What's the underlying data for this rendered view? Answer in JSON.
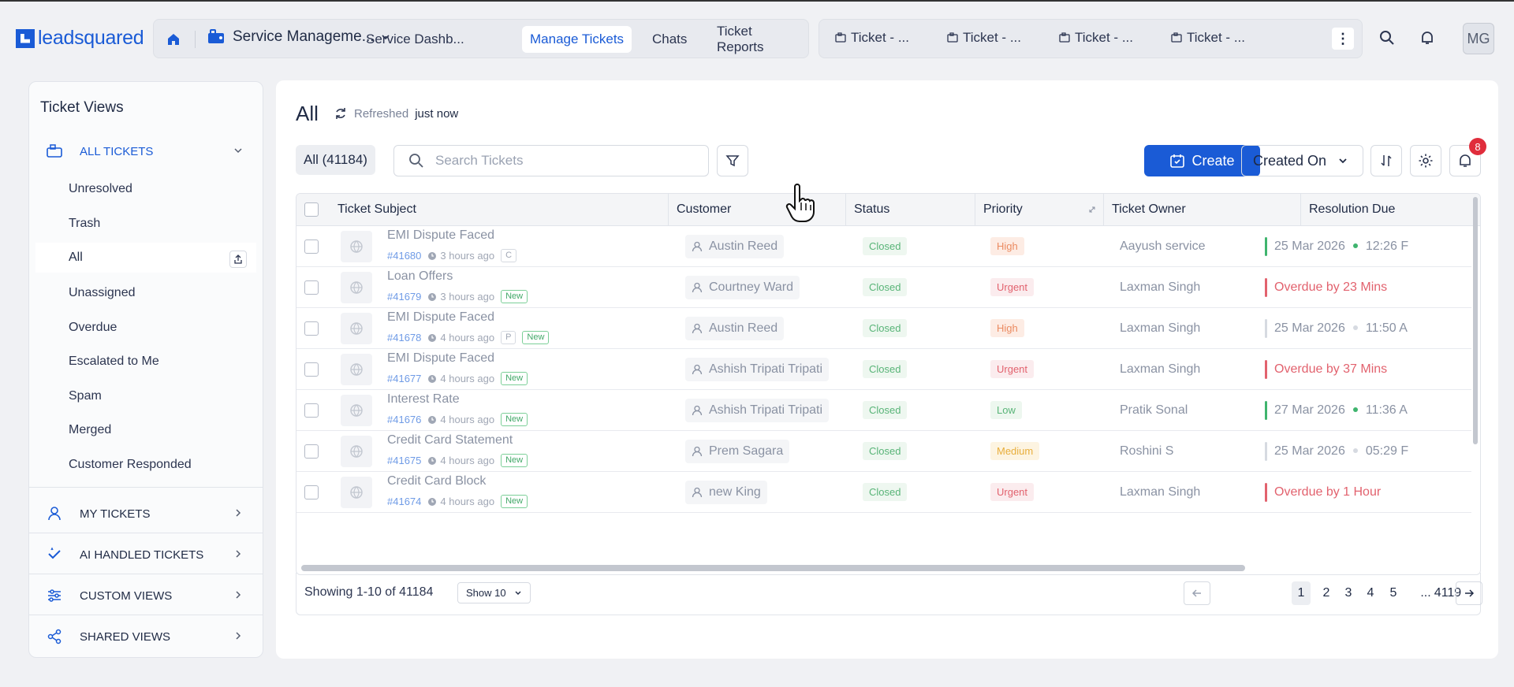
{
  "brand": {
    "name": "leadsquared"
  },
  "nav": {
    "app_name": "Service Manageme...",
    "tabs": [
      "Service Dashb...",
      "Manage Tickets",
      "Chats",
      "Ticket Reports"
    ],
    "active_tab": "Manage Tickets",
    "recent_tabs": [
      "Ticket - ...",
      "Ticket - ...",
      "Ticket - ...",
      "Ticket - ..."
    ],
    "avatar": "MG"
  },
  "sidebar": {
    "title": "Ticket Views",
    "sections": [
      {
        "label": "ALL TICKETS",
        "icon": "tickets-icon",
        "expanded": true
      },
      {
        "label": "MY TICKETS",
        "icon": "user-icon"
      },
      {
        "label": "AI HANDLED TICKETS",
        "icon": "ai-check-icon"
      },
      {
        "label": "CUSTOM VIEWS",
        "icon": "sliders-icon"
      },
      {
        "label": "SHARED VIEWS",
        "icon": "share-icon"
      }
    ],
    "items": [
      "Unresolved",
      "Trash",
      "All",
      "Unassigned",
      "Overdue",
      "Escalated to Me",
      "Spam",
      "Merged",
      "Customer Responded"
    ],
    "active_item": "All"
  },
  "main": {
    "title": "All",
    "refresh_label": "Refreshed",
    "refresh_time": "just now",
    "count_chip": "All (41184)",
    "search_placeholder": "Search Tickets",
    "create_label": "Create",
    "sort_label": "Created On",
    "notifications_count": "8"
  },
  "table": {
    "columns": [
      "Ticket Subject",
      "Customer",
      "Status",
      "Priority",
      "Ticket Owner",
      "Resolution Due"
    ],
    "rows": [
      {
        "subject": "EMI Dispute Faced",
        "id": "#41680",
        "ago": "3 hours ago",
        "tags": [
          "C"
        ],
        "customer": "Austin Reed",
        "status": "Closed",
        "priority": "High",
        "owner": "Aayush service",
        "due": "25 Mar 2026",
        "due_time": "12:26 F",
        "overdue": false,
        "bar": "#3fb46e",
        "dot": "#3fb46e"
      },
      {
        "subject": "Loan Offers",
        "id": "#41679",
        "ago": "3 hours ago",
        "tags": [
          "New"
        ],
        "customer": "Courtney Ward",
        "status": "Closed",
        "priority": "Urgent",
        "owner": "Laxman Singh",
        "due": "Overdue by 23 Mins",
        "due_time": "",
        "overdue": true,
        "bar": "#e2626e",
        "dot": ""
      },
      {
        "subject": "EMI Dispute Faced",
        "id": "#41678",
        "ago": "4 hours ago",
        "tags": [
          "P",
          "New"
        ],
        "customer": "Austin Reed",
        "status": "Closed",
        "priority": "High",
        "owner": "Laxman Singh",
        "due": "25 Mar 2026",
        "due_time": "11:50 A",
        "overdue": false,
        "bar": "#d6dae1",
        "dot": "#d6dae1"
      },
      {
        "subject": "EMI Dispute Faced",
        "id": "#41677",
        "ago": "4 hours ago",
        "tags": [
          "New"
        ],
        "customer": "Ashish Tripati Tripati",
        "status": "Closed",
        "priority": "Urgent",
        "owner": "Laxman Singh",
        "due": "Overdue by 37 Mins",
        "due_time": "",
        "overdue": true,
        "bar": "#e2626e",
        "dot": ""
      },
      {
        "subject": "Interest Rate",
        "id": "#41676",
        "ago": "4 hours ago",
        "tags": [
          "New"
        ],
        "customer": "Ashish Tripati Tripati",
        "status": "Closed",
        "priority": "Low",
        "owner": "Pratik Sonal",
        "due": "27 Mar 2026",
        "due_time": "11:36 A",
        "overdue": false,
        "bar": "#3fb46e",
        "dot": "#3fb46e"
      },
      {
        "subject": "Credit Card Statement",
        "id": "#41675",
        "ago": "4 hours ago",
        "tags": [
          "New"
        ],
        "customer": "Prem Sagara",
        "status": "Closed",
        "priority": "Medium",
        "owner": "Roshini S",
        "due": "25 Mar 2026",
        "due_time": "05:29 F",
        "overdue": false,
        "bar": "#d6dae1",
        "dot": "#d6dae1"
      },
      {
        "subject": "Credit Card Block",
        "id": "#41674",
        "ago": "4 hours ago",
        "tags": [
          "New"
        ],
        "customer": "new King",
        "status": "Closed",
        "priority": "Urgent",
        "owner": "Laxman Singh",
        "due": "Overdue by 1 Hour",
        "due_time": "",
        "overdue": true,
        "bar": "#e2626e",
        "dot": ""
      }
    ]
  },
  "footer": {
    "showing": "Showing 1-10 of 41184",
    "per_page": "Show 10",
    "pages": [
      "1",
      "2",
      "3",
      "4",
      "5",
      "...",
      "4119"
    ],
    "current_page": "1"
  },
  "colors": {
    "accent": "#1a5bd6",
    "danger": "#e2626e",
    "success": "#3fb46e"
  }
}
